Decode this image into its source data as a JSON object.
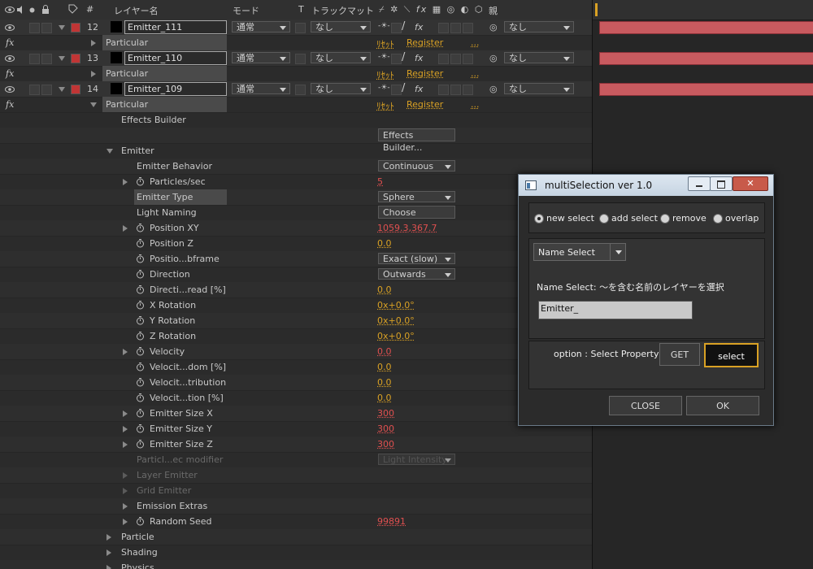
{
  "header": {
    "layer_name_col": "レイヤー名",
    "mode_col": "モード",
    "t_col": "T",
    "trackmatte_col": "トラックマット",
    "switches_col": "fx",
    "parent_col": "親",
    "hash": "#"
  },
  "layers": [
    {
      "num": "12",
      "name": "Emitter_111",
      "mode": "通常",
      "matte": "なし",
      "parent": "なし",
      "effect": "Particular",
      "reset": "ﾘｾｯﾄ",
      "register": "Register",
      "more": "..."
    },
    {
      "num": "13",
      "name": "Emitter_110",
      "mode": "通常",
      "matte": "なし",
      "parent": "なし",
      "effect": "Particular",
      "reset": "ﾘｾｯﾄ",
      "register": "Register",
      "more": "..."
    },
    {
      "num": "14",
      "name": "Emitter_109",
      "mode": "通常",
      "matte": "なし",
      "parent": "なし",
      "effect": "Particular",
      "reset": "ﾘｾｯﾄ",
      "register": "Register",
      "more": "..."
    }
  ],
  "props": [
    {
      "label": "Effects Builder",
      "value": ""
    },
    {
      "label": "",
      "value": "Effects Builder..."
    },
    {
      "label": "Emitter",
      "value": ""
    },
    {
      "label": "Emitter Behavior",
      "value": "Continuous"
    },
    {
      "label": "Particles/sec",
      "value": "5"
    },
    {
      "label": "Emitter Type",
      "value": "Sphere"
    },
    {
      "label": "Light Naming",
      "value": "Choose Names..."
    },
    {
      "label": "Position XY",
      "value": "1059.3,367.7"
    },
    {
      "label": "Position Z",
      "value": "0.0"
    },
    {
      "label": "Positio...bframe",
      "value": "Exact (slow)"
    },
    {
      "label": "Direction",
      "value": "Outwards"
    },
    {
      "label": "Directi...read [%]",
      "value": "0.0"
    },
    {
      "label": "X Rotation",
      "value": "0x+0.0°"
    },
    {
      "label": "Y Rotation",
      "value": "0x+0.0°"
    },
    {
      "label": "Z Rotation",
      "value": "0x+0.0°"
    },
    {
      "label": "Velocity",
      "value": "0.0"
    },
    {
      "label": "Velocit...dom [%]",
      "value": "0.0"
    },
    {
      "label": "Velocit...tribution",
      "value": "0.0"
    },
    {
      "label": "Velocit...tion [%]",
      "value": "0.0"
    },
    {
      "label": "Emitter Size X",
      "value": "300"
    },
    {
      "label": "Emitter Size Y",
      "value": "300"
    },
    {
      "label": "Emitter Size Z",
      "value": "300"
    },
    {
      "label": "Particl...ec modifier",
      "value": "Light Intensity"
    },
    {
      "label": "Layer Emitter",
      "value": ""
    },
    {
      "label": "Grid Emitter",
      "value": ""
    },
    {
      "label": "Emission Extras",
      "value": ""
    },
    {
      "label": "Random Seed",
      "value": "99891"
    },
    {
      "label": "Particle",
      "value": ""
    },
    {
      "label": "Shading",
      "value": ""
    },
    {
      "label": "Physics",
      "value": ""
    }
  ],
  "dialog": {
    "title": "multiSelection ver 1.0",
    "radios": [
      "new select",
      "add select",
      "remove",
      "overlap"
    ],
    "dropdown": "Name Select",
    "desc": "Name Select: 〜を含む名前のレイヤーを選択",
    "input_value": "Emitter_",
    "option_label": "option : Select Property",
    "get": "GET",
    "select": "select",
    "close": "CLOSE",
    "ok": "OK"
  },
  "colors": {
    "label_red": "#c03535",
    "accent_yellow": "#d9a124",
    "value_red": "#e05050",
    "bar": "#c85a5f"
  }
}
